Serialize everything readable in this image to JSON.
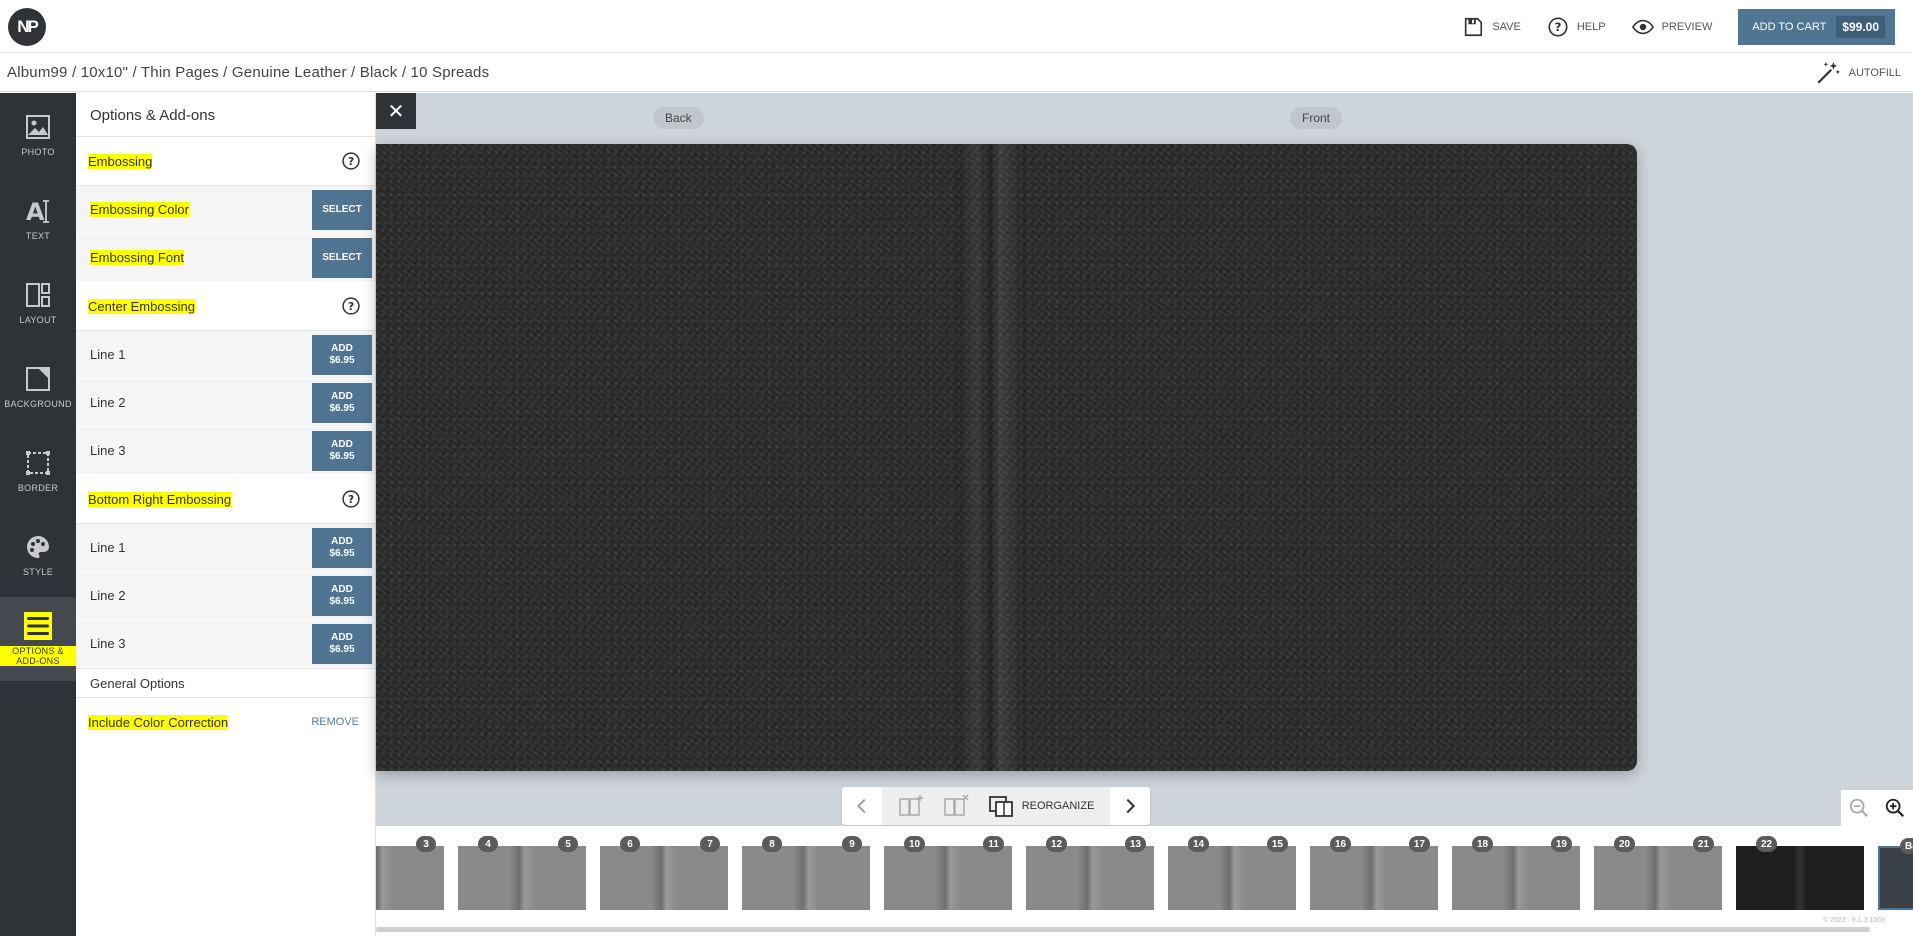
{
  "app": {
    "logo_text": "NP"
  },
  "topbar": {
    "save_label": "SAVE",
    "help_label": "HELP",
    "preview_label": "PREVIEW",
    "cart_label": "ADD TO CART",
    "cart_price": "$99.00"
  },
  "breadcrumb": {
    "text": "Album99 / 10x10\" / Thin Pages / Genuine Leather / Black / 10 Spreads"
  },
  "autofill_label": "AUTOFILL",
  "rail": {
    "items": [
      {
        "label": "PHOTO",
        "icon": "photo-icon"
      },
      {
        "label": "TEXT",
        "icon": "text-icon"
      },
      {
        "label": "LAYOUT",
        "icon": "layout-icon"
      },
      {
        "label": "BACKGROUND",
        "icon": "background-icon"
      },
      {
        "label": "BORDER",
        "icon": "border-icon"
      },
      {
        "label": "STYLE",
        "icon": "palette-icon"
      },
      {
        "label": "OPTIONS & ADD-ONS",
        "icon": "menu-icon"
      }
    ]
  },
  "panel": {
    "title": "Options & Add-ons",
    "embossing": {
      "title": "Embossing",
      "color_label": "Embossing Color",
      "font_label": "Embossing Font",
      "select_label": "SELECT"
    },
    "center": {
      "title": "Center Embossing",
      "lines": [
        "Line 1",
        "Line 2",
        "Line 3"
      ]
    },
    "bottom_right": {
      "title": "Bottom Right Embossing",
      "lines": [
        "Line 1",
        "Line 2",
        "Line 3"
      ]
    },
    "add_label": "ADD",
    "add_price": "$6.95",
    "general": {
      "title": "General Options",
      "color_correction": "Include Color Correction",
      "remove_label": "REMOVE"
    }
  },
  "canvas": {
    "back_label": "Back",
    "front_label": "Front",
    "close_symbol": "✕",
    "cover_color": "#2b2b2b"
  },
  "pager": {
    "reorganize_label": "REORGANIZE"
  },
  "thumbs": {
    "pages": [
      {
        "left": "",
        "right": "3"
      },
      {
        "left": "4",
        "right": "5"
      },
      {
        "left": "6",
        "right": "7"
      },
      {
        "left": "8",
        "right": "9"
      },
      {
        "left": "10",
        "right": "11"
      },
      {
        "left": "12",
        "right": "13"
      },
      {
        "left": "14",
        "right": "15"
      },
      {
        "left": "16",
        "right": "17"
      },
      {
        "left": "18",
        "right": "19"
      },
      {
        "left": "20",
        "right": "21"
      },
      {
        "left": "22",
        "right": ""
      },
      {
        "left": "Ba",
        "right": ""
      }
    ],
    "copyright": "© 2023 · 8.1.3.1069"
  },
  "colors": {
    "accent": "#4f7593",
    "rail_bg": "#2f3237",
    "highlight": "#ffff00"
  }
}
